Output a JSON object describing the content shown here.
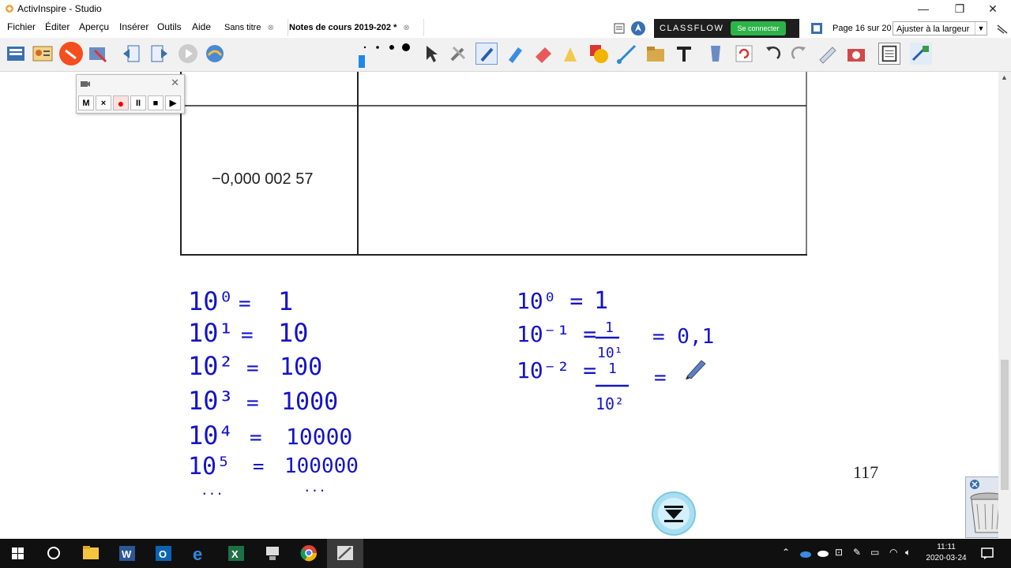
{
  "window": {
    "title": "ActivInspire - Studio"
  },
  "menu": {
    "items": [
      "Fichier",
      "Éditer",
      "Aperçu",
      "Insérer",
      "Outils",
      "Aide"
    ]
  },
  "tabs": [
    {
      "label": "Sans titre",
      "active": false
    },
    {
      "label": "Notes de cours 2019-202 *",
      "active": true
    }
  ],
  "classflow": {
    "logo": "CLASSFLOW",
    "connect_label": "Se connecter"
  },
  "page_info": "Page 16 sur 20",
  "zoom": {
    "value": "Ajuster à la largeur"
  },
  "palette": {
    "colors": [
      "#ff0000",
      "#ff8000",
      "#ffff99",
      "#00e000",
      "#a0ff60",
      "#8b4513",
      "#f5c89a",
      "#ff99cc",
      "#b00000",
      "#00c0ff",
      "#0000ff",
      "#a020f0",
      "#ff00a0",
      "#000000",
      "#606060",
      "#60ffff",
      "#ffffff"
    ]
  },
  "recorder": {
    "buttons": [
      "M",
      "×",
      "●",
      "II",
      "■",
      "▶"
    ]
  },
  "table": {
    "cell_value": "−0,000 002 57"
  },
  "handwriting": {
    "left_rows": [
      {
        "exp": "10⁰",
        "val": "1"
      },
      {
        "exp": "10¹",
        "val": "10"
      },
      {
        "exp": "10²",
        "val": "100"
      },
      {
        "exp": "10³",
        "val": "1000"
      },
      {
        "exp": "10⁴",
        "val": "10000"
      },
      {
        "exp": "10⁵",
        "val": "100000"
      },
      {
        "exp": "...",
        "val": "..."
      }
    ],
    "right_rows": [
      {
        "lhs": "10⁰ =",
        "val": "1"
      },
      {
        "lhs": "10⁻¹ =",
        "frac_num": "1",
        "frac_den": "10¹",
        "rhs": "= 0,1"
      },
      {
        "lhs": "10⁻² =",
        "frac_num": "1",
        "frac_den": "10²",
        "rhs": "="
      }
    ]
  },
  "page_number": "117",
  "taskbar": {
    "time": "11:11",
    "date": "2020-03-24"
  }
}
